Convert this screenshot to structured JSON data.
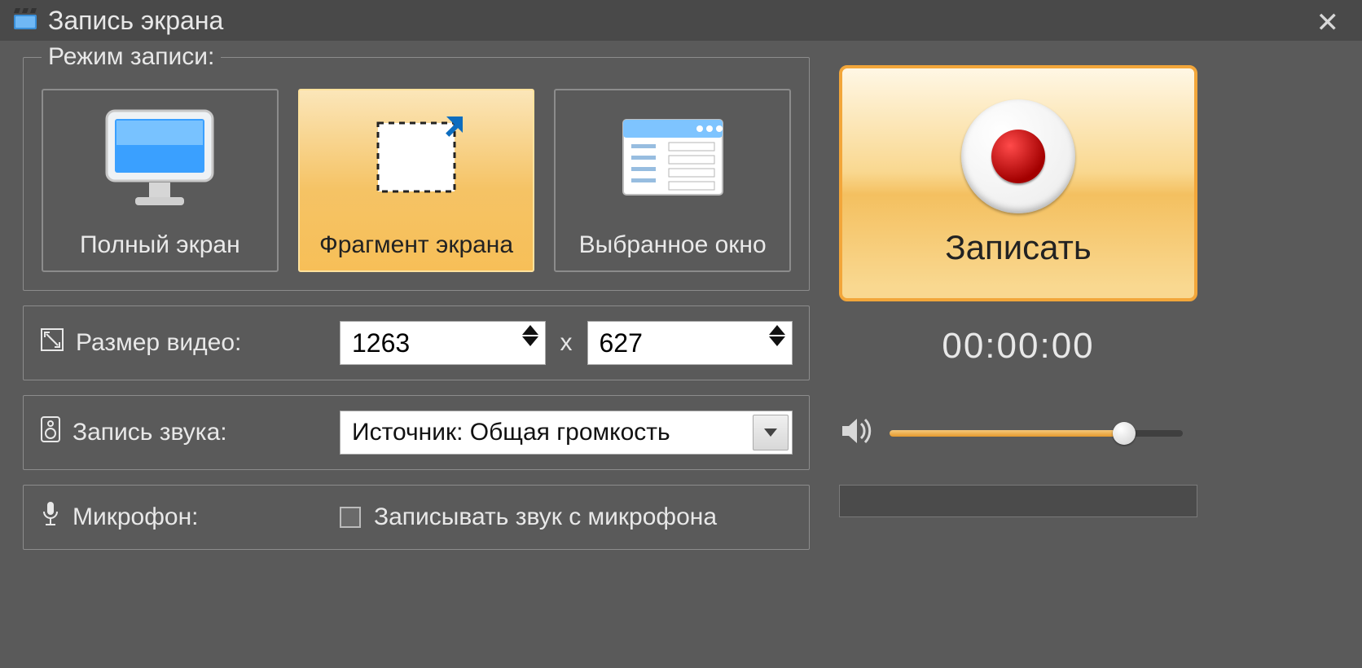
{
  "window": {
    "title": "Запись экрана"
  },
  "group": {
    "title": "Режим записи:"
  },
  "modes": {
    "fullscreen": {
      "label": "Полный экран"
    },
    "region": {
      "label": "Фрагмент экрана",
      "selected": true
    },
    "window": {
      "label": "Выбранное окно"
    }
  },
  "videoSize": {
    "label": "Размер видео:",
    "width": "1263",
    "height": "627",
    "separator": "x"
  },
  "audio": {
    "label": "Запись звука:",
    "source": "Источник: Общая громкость"
  },
  "mic": {
    "label": "Микрофон:",
    "checkboxLabel": "Записывать звук с микрофона",
    "checked": false
  },
  "record": {
    "label": "Записать"
  },
  "timer": {
    "value": "00:00:00"
  },
  "volume": {
    "percent": 80
  }
}
